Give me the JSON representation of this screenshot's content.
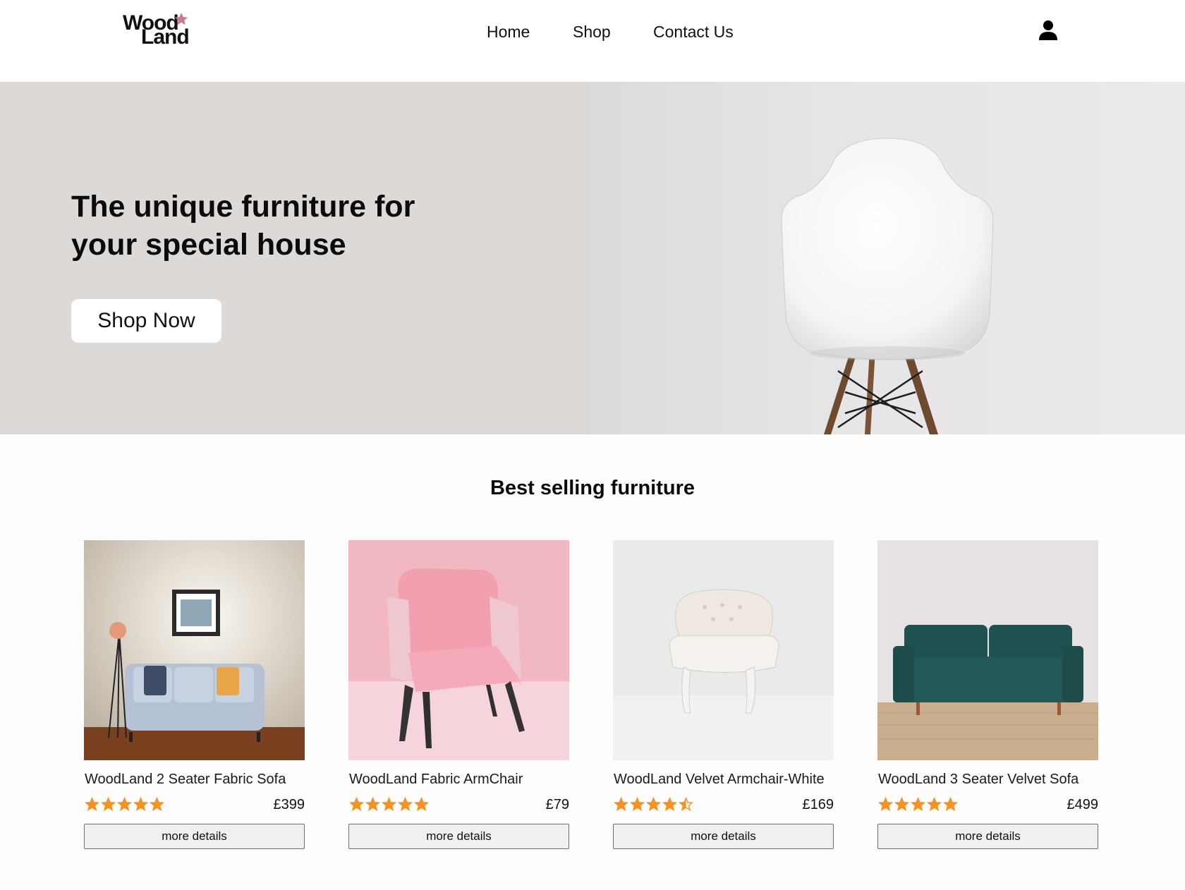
{
  "brand": {
    "logo_word1": "Wood",
    "logo_word2": "Land",
    "accent_color": "#c97b8a"
  },
  "nav": {
    "items": [
      {
        "label": "Home"
      },
      {
        "label": "Shop"
      },
      {
        "label": "Contact Us"
      }
    ],
    "account_icon": "user-icon"
  },
  "hero": {
    "title_line1": "The unique furniture for",
    "title_line2": "your special house",
    "cta_label": "Shop Now",
    "image": "white-chair-photo",
    "background_color": "#ddd9d7"
  },
  "best_selling": {
    "title": "Best selling furniture",
    "star_color": "#f7911f",
    "products": [
      {
        "name": "WoodLand 2 Seater Fabric Sofa",
        "rating": 5,
        "price": "£399",
        "button_label": "more details",
        "image": "grey-fabric-sofa-photo"
      },
      {
        "name": "WoodLand Fabric ArmChair",
        "rating": 5,
        "price": "£79",
        "button_label": "more details",
        "image": "pink-armchair-photo"
      },
      {
        "name": "WoodLand Velvet Armchair-White",
        "rating": 4.5,
        "price": "£169",
        "button_label": "more details",
        "image": "white-tufted-armchair-photo"
      },
      {
        "name": "WoodLand 3 Seater Velvet Sofa",
        "rating": 5,
        "price": "£499",
        "button_label": "more details",
        "image": "green-velvet-sofa-photo"
      }
    ]
  }
}
